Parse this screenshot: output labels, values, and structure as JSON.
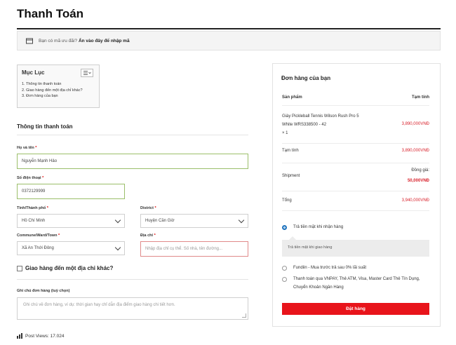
{
  "page": {
    "title": "Thanh Toán"
  },
  "coupon": {
    "text": "Bạn có mã ưu đãi?",
    "link": "Ấn vào đây để nhập mã",
    "icon": "coupon-icon"
  },
  "toc": {
    "title": "Mục Lục",
    "toggle_icon": "list-toggle-icon",
    "items": [
      "1. Thông tin thanh toán",
      "2. Giao hàng đến một địa chỉ khác?",
      "3. Đơn hàng của bạn"
    ]
  },
  "billing": {
    "section_title": "Thông tin thanh toán",
    "name_label": "Họ và tên",
    "name_value": "Nguyễn Mạnh Hảo",
    "phone_label": "Số điện thoại",
    "phone_value": "0372129999",
    "province_label": "Tỉnh/Thành phố",
    "province_value": "Hồ Chí Minh",
    "district_label": "District",
    "district_value": "Huyện Cần Giờ",
    "ward_label": "Commune/Ward/Town",
    "ward_value": "Xã An Thới Đông",
    "address_label": "Địa chỉ",
    "address_placeholder": "Nhập địa chỉ cụ thể. Số nhà, tên đường...",
    "required_mark": "*"
  },
  "shipping_other": {
    "label": "Giao hàng đến một địa chỉ khác?"
  },
  "notes": {
    "label": "Ghi chú đơn hàng (tuỳ chọn)",
    "placeholder": "Ghi chú về đơn hàng, ví dụ: thời gian hay chỉ dẫn địa điểm giao hàng chi tiết hơn."
  },
  "footer": {
    "post_views": "Post Views: 17.024",
    "icon": "bar-chart-icon"
  },
  "order": {
    "title": "Đơn hàng của bạn",
    "col_product": "Sản phẩm",
    "col_subtotal": "Tạm tính",
    "product_name_line1": "Giày Pickleball Tennis Wilson Rush Pro 5",
    "product_name_line2": "White WRS338500 - 42",
    "product_qty": "× 1",
    "product_price": "3,890,000VNĐ",
    "subtotal_label": "Tạm tính",
    "subtotal_value": "3,890,000VNĐ",
    "shipment_label": "Shipment",
    "shipment_method": "Đồng giá:",
    "shipment_value": "50,000VNĐ",
    "total_label": "Tổng",
    "total_value": "3,940,000VNĐ"
  },
  "payment": {
    "options": [
      {
        "label": "Trả tiền mặt khi nhận hàng",
        "selected": true
      },
      {
        "label": "Fundiin - Mua trước trả sau 0% lãi suất",
        "selected": false
      },
      {
        "label": "Thanh toán qua VNPAY, Thẻ ATM, Visa, Master Card Thẻ Tín Dụng, Chuyển Khoản Ngân Hàng",
        "selected": false
      }
    ],
    "cod_description": "Trả tiền mặt khi giao hàng",
    "place_order_label": "Đặt hàng"
  },
  "colors": {
    "accent_red": "#e8141b",
    "price_red": "#d9232d",
    "valid_green": "#9bbf6a",
    "error_red": "#e08a8a",
    "radio_blue": "#1e73be"
  }
}
